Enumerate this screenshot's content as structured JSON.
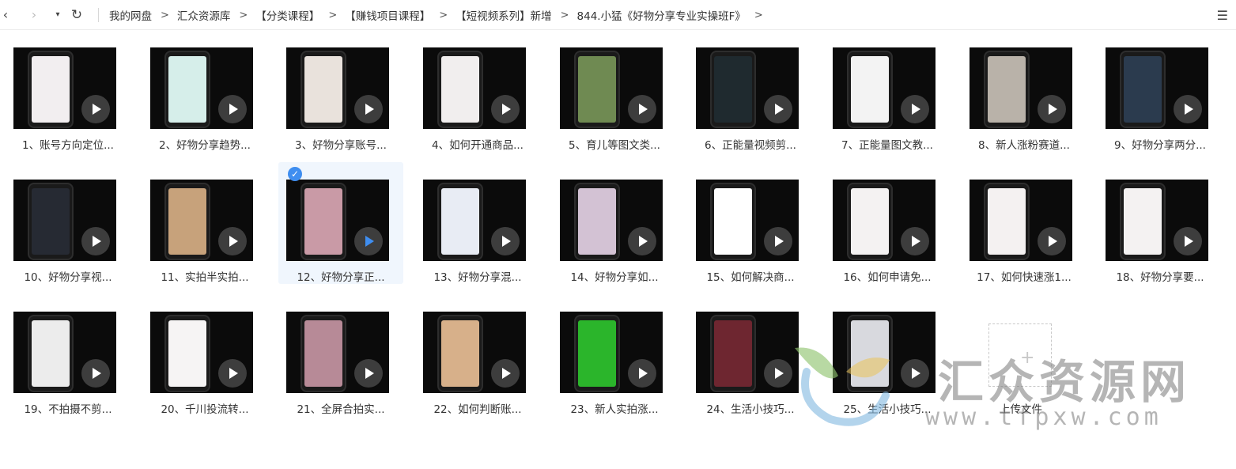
{
  "nav": {
    "back_icon": "‹",
    "forward_icon": "›",
    "dropdown_icon": "▾",
    "refresh_icon": "↻",
    "view_icon": "☰"
  },
  "breadcrumb": [
    "我的网盘",
    "汇众资源库",
    "【分类课程】",
    "【赚钱项目课程】",
    "【短视频系列】新增",
    "844.小猛《好物分享专业实操班F》"
  ],
  "breadcrumb_separator": ">",
  "files": [
    {
      "label": "1、账号方向定位...",
      "screen": "#f2eef0"
    },
    {
      "label": "2、好物分享趋势...",
      "screen": "#d6eeea"
    },
    {
      "label": "3、好物分享账号...",
      "screen": "#e9e2dc"
    },
    {
      "label": "4、如何开通商品...",
      "screen": "#f1eeee"
    },
    {
      "label": "5、育儿等图文类...",
      "screen": "#6f8a52"
    },
    {
      "label": "6、正能量视频剪...",
      "screen": "#1f2a2f"
    },
    {
      "label": "7、正能量图文教...",
      "screen": "#f3f3f3"
    },
    {
      "label": "8、新人涨粉赛道...",
      "screen": "#b9b2a9"
    },
    {
      "label": "9、好物分享两分...",
      "screen": "#2b3b4e"
    },
    {
      "label": "10、好物分享视...",
      "screen": "#262a33"
    },
    {
      "label": "11、实拍半实拍...",
      "screen": "#c7a27b"
    },
    {
      "label": "12、好物分享正...",
      "screen": "#c99aa6"
    },
    {
      "label": "13、好物分享混...",
      "screen": "#e8ecf4"
    },
    {
      "label": "14、好物分享如...",
      "screen": "#d3c2d4"
    },
    {
      "label": "15、如何解决商...",
      "screen": "#ffffff"
    },
    {
      "label": "16、如何申请免...",
      "screen": "#f4f2f2"
    },
    {
      "label": "17、如何快速涨1...",
      "screen": "#f4f1f1"
    },
    {
      "label": "18、好物分享要...",
      "screen": "#f4f2f2"
    },
    {
      "label": "19、不拍摄不剪...",
      "screen": "#ececec"
    },
    {
      "label": "20、千川投流转...",
      "screen": "#f6f4f4"
    },
    {
      "label": "21、全屏合拍实...",
      "screen": "#b78a97"
    },
    {
      "label": "22、如何判断账...",
      "screen": "#d7b08a"
    },
    {
      "label": "23、新人实拍涨...",
      "screen": "#2bb52b"
    },
    {
      "label": "24、生活小技巧...",
      "screen": "#6e2630"
    },
    {
      "label": "25、生活小技巧...",
      "screen": "#d8d9de"
    }
  ],
  "selected_index": 11,
  "upload": {
    "label": "上传文件",
    "icon": "+"
  },
  "watermark": {
    "text": "汇众资源网",
    "url": "www.tfpxw.com"
  }
}
